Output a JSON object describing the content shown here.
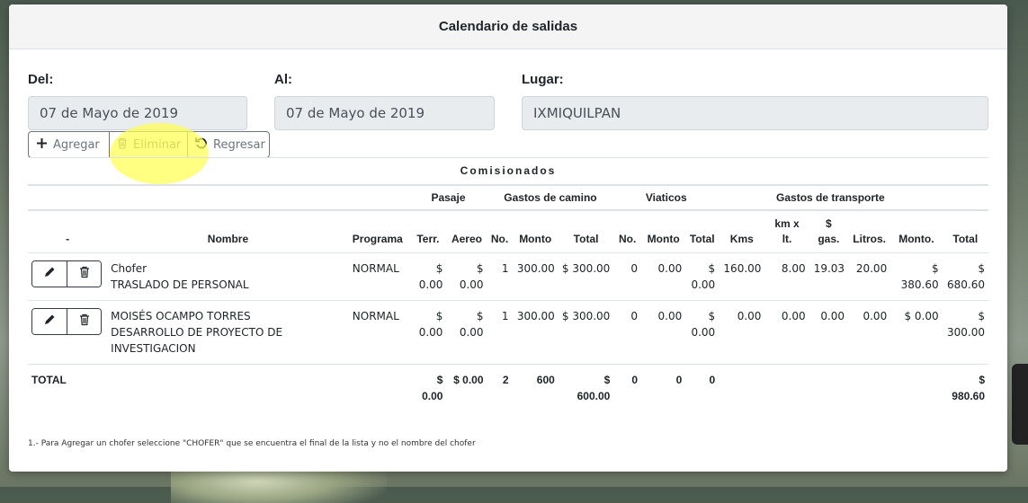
{
  "modal": {
    "title": "Calendario de salidas"
  },
  "fields": {
    "del": {
      "label": "Del:",
      "value": "07 de Mayo de 2019"
    },
    "al": {
      "label": "Al:",
      "value": "07 de Mayo de 2019"
    },
    "lugar": {
      "label": "Lugar:",
      "value": "IXMIQUILPAN"
    }
  },
  "toolbar": {
    "agregar": {
      "label": "Agregar",
      "icon": "plus-icon"
    },
    "eliminar": {
      "label": "Eliminar",
      "icon": "trash-icon"
    },
    "regresar": {
      "label": "Regresar",
      "icon": "undo-icon"
    }
  },
  "table": {
    "section_title": "Comisionados",
    "groups": {
      "pasaje": "Pasaje",
      "gastos_camino": "Gastos de camino",
      "viaticos": "Viaticos",
      "gastos_transporte": "Gastos de transporte"
    },
    "columns": {
      "dash": "-",
      "nombre": "Nombre",
      "programa": "Programa",
      "terr": "Terr.",
      "aereo": "Aereo",
      "gc_no": "No.",
      "gc_monto": "Monto",
      "gc_total": "Total",
      "v_no": "No.",
      "v_monto": "Monto",
      "v_total": "Total",
      "kms": "Kms",
      "kmxlt_1": "km x",
      "kmxlt_2": "lt.",
      "gas_1": "$",
      "gas_2": "gas.",
      "litros": "Litros.",
      "monto": "Monto.",
      "total": "Total"
    },
    "rows": [
      {
        "nombre_1": "Chofer",
        "nombre_2": "TRASLADO DE PERSONAL",
        "nombre_3": "",
        "programa": "NORMAL",
        "terr": "$ 0.00",
        "aereo": "$ 0.00",
        "gc_no": "1",
        "gc_monto": "300.00",
        "gc_total": "$ 300.00",
        "v_no": "0",
        "v_monto": "0.00",
        "v_total": "$ 0.00",
        "kms": "160.00",
        "kmxlt": "8.00",
        "gas": "19.03",
        "litros": "20.00",
        "monto": "$ 380.60",
        "total": "$ 680.60"
      },
      {
        "nombre_1": "MOISÉS OCAMPO TORRES",
        "nombre_2": "DESARROLLO DE PROYECTO DE",
        "nombre_3": "INVESTIGACION",
        "programa": "NORMAL",
        "terr": "$ 0.00",
        "aereo": "$ 0.00",
        "gc_no": "1",
        "gc_monto": "300.00",
        "gc_total": "$ 300.00",
        "v_no": "0",
        "v_monto": "0.00",
        "v_total": "$ 0.00",
        "kms": "0.00",
        "kmxlt": "0.00",
        "gas": "0.00",
        "litros": "0.00",
        "monto": "$ 0.00",
        "total": "$ 300.00"
      }
    ],
    "totals": {
      "label": "TOTAL",
      "terr_1": "$",
      "terr_2": "0.00",
      "aereo": "$ 0.00",
      "gc_no": "2",
      "gc_monto": "600",
      "gc_total_1": "$",
      "gc_total_2": "600.00",
      "v_no": "0",
      "v_monto": "0",
      "v_total": "0",
      "total_1": "$",
      "total_2": "980.60"
    }
  },
  "footnote": "1.- Para Agregar un chofer seleccione \"CHOFER\" que se encuentra el final de la lista y no el nombre del chofer"
}
